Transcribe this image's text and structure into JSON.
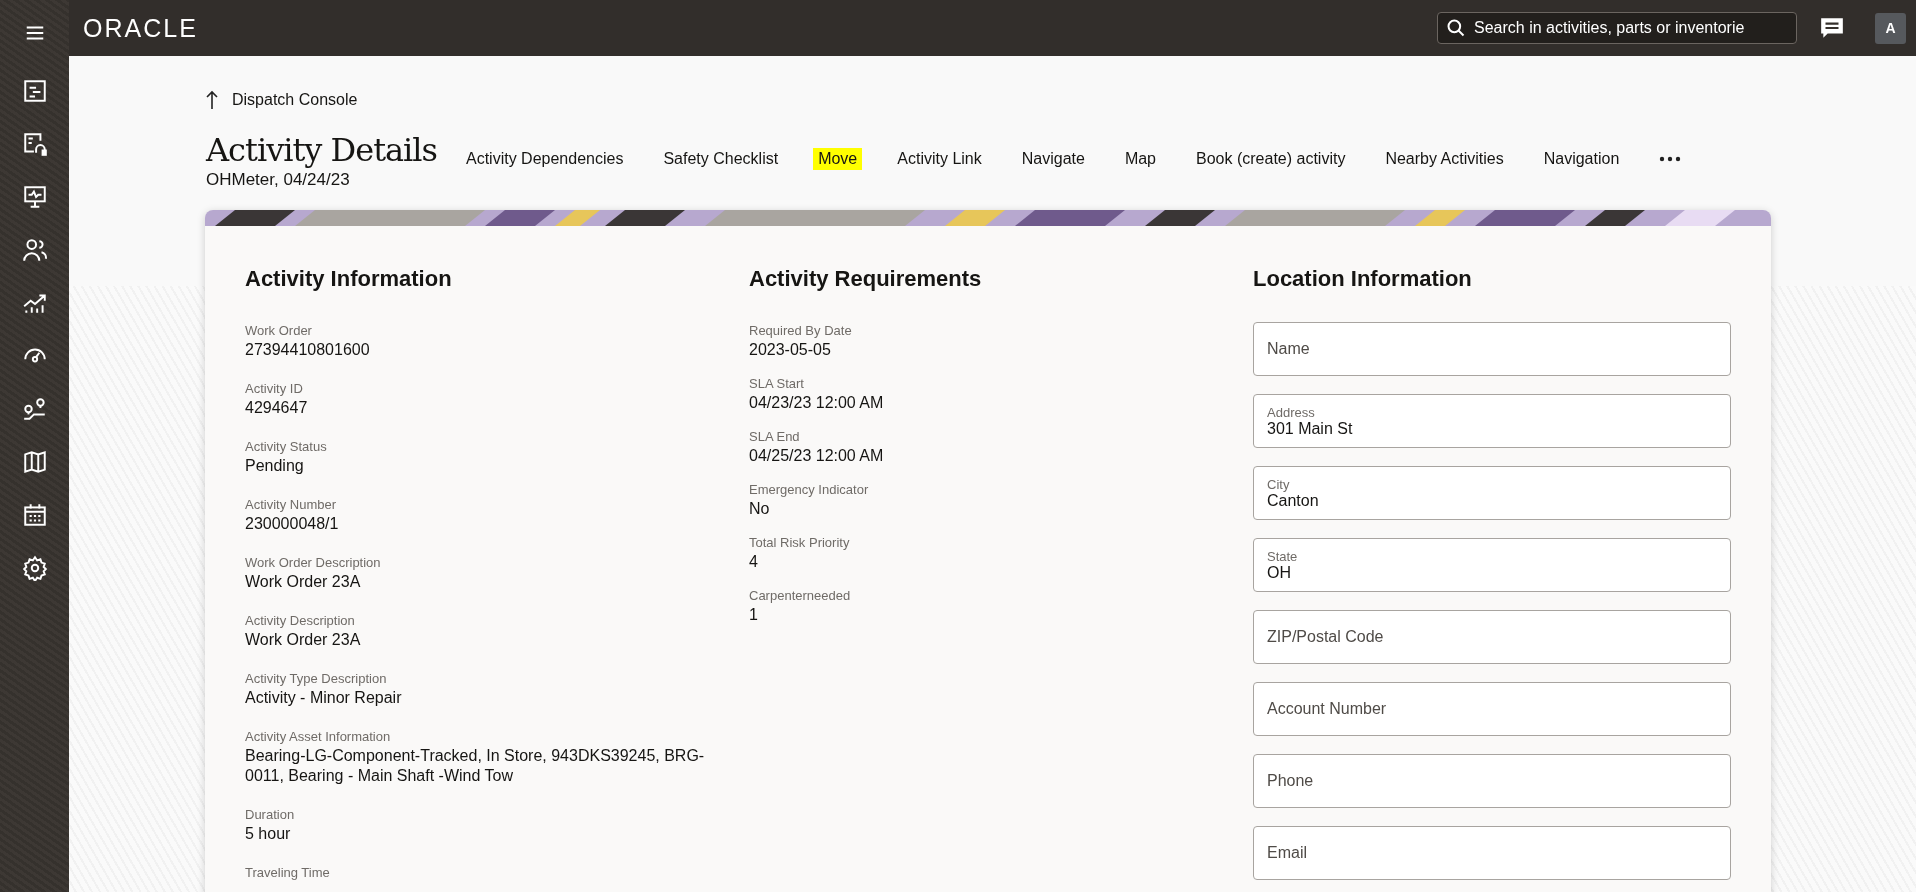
{
  "topbar": {
    "logo": "ORACLE",
    "search": {
      "placeholder": "Search in activities, parts or inventorie"
    },
    "avatar": "A"
  },
  "back_link": "Dispatch Console",
  "title": "Activity Details",
  "subtitle": "OHMeter, 04/24/23",
  "actions": [
    {
      "label": "Activity Dependencies",
      "highlighted": false
    },
    {
      "label": "Safety Checklist",
      "highlighted": false
    },
    {
      "label": "Move",
      "highlighted": true
    },
    {
      "label": "Activity Link",
      "highlighted": false
    },
    {
      "label": "Navigate",
      "highlighted": false
    },
    {
      "label": "Map",
      "highlighted": false
    },
    {
      "label": "Book (create) activity",
      "highlighted": false
    },
    {
      "label": "Nearby Activities",
      "highlighted": false
    },
    {
      "label": "Navigation",
      "highlighted": false
    }
  ],
  "sections": [
    {
      "title": "Activity Information",
      "fields": [
        {
          "label": "Work Order",
          "value": "27394410801600"
        },
        {
          "label": "Activity ID",
          "value": "4294647"
        },
        {
          "label": "Activity Status",
          "value": "Pending"
        },
        {
          "label": "Activity Number",
          "value": "230000048/1"
        },
        {
          "label": "Work Order Description",
          "value": "Work Order 23A"
        },
        {
          "label": "Activity Description",
          "value": "Work Order 23A"
        },
        {
          "label": "Activity Type Description",
          "value": "Activity - Minor Repair"
        },
        {
          "label": "Activity Asset Information",
          "value": "Bearing-LG-Component-Tracked, In Store, 943DKS39245, BRG-0011, Bearing - Main Shaft -Wind Tow"
        },
        {
          "label": "Duration",
          "value": "5 hour"
        },
        {
          "label": "Traveling Time"
        }
      ]
    },
    {
      "title": "Activity Requirements",
      "fields": [
        {
          "label": "Required By Date",
          "value": "2023-05-05"
        },
        {
          "label": "SLA Start",
          "value": "04/23/23 12:00 AM"
        },
        {
          "label": "SLA End",
          "value": "04/25/23 12:00 AM"
        },
        {
          "label": "Emergency Indicator",
          "value": "No"
        },
        {
          "label": "Total Risk Priority",
          "value": "4"
        },
        {
          "label": "Carpenterneeded",
          "value": "1"
        }
      ]
    }
  ],
  "location": {
    "title": "Location Information",
    "fields": [
      {
        "label": "Name"
      },
      {
        "label": "Address",
        "value": "301 Main St"
      },
      {
        "label": "City",
        "value": "Canton"
      },
      {
        "label": "State",
        "value": "OH"
      },
      {
        "label": "ZIP/Postal Code"
      },
      {
        "label": "Account Number"
      },
      {
        "label": "Phone"
      },
      {
        "label": "Email"
      }
    ]
  }
}
